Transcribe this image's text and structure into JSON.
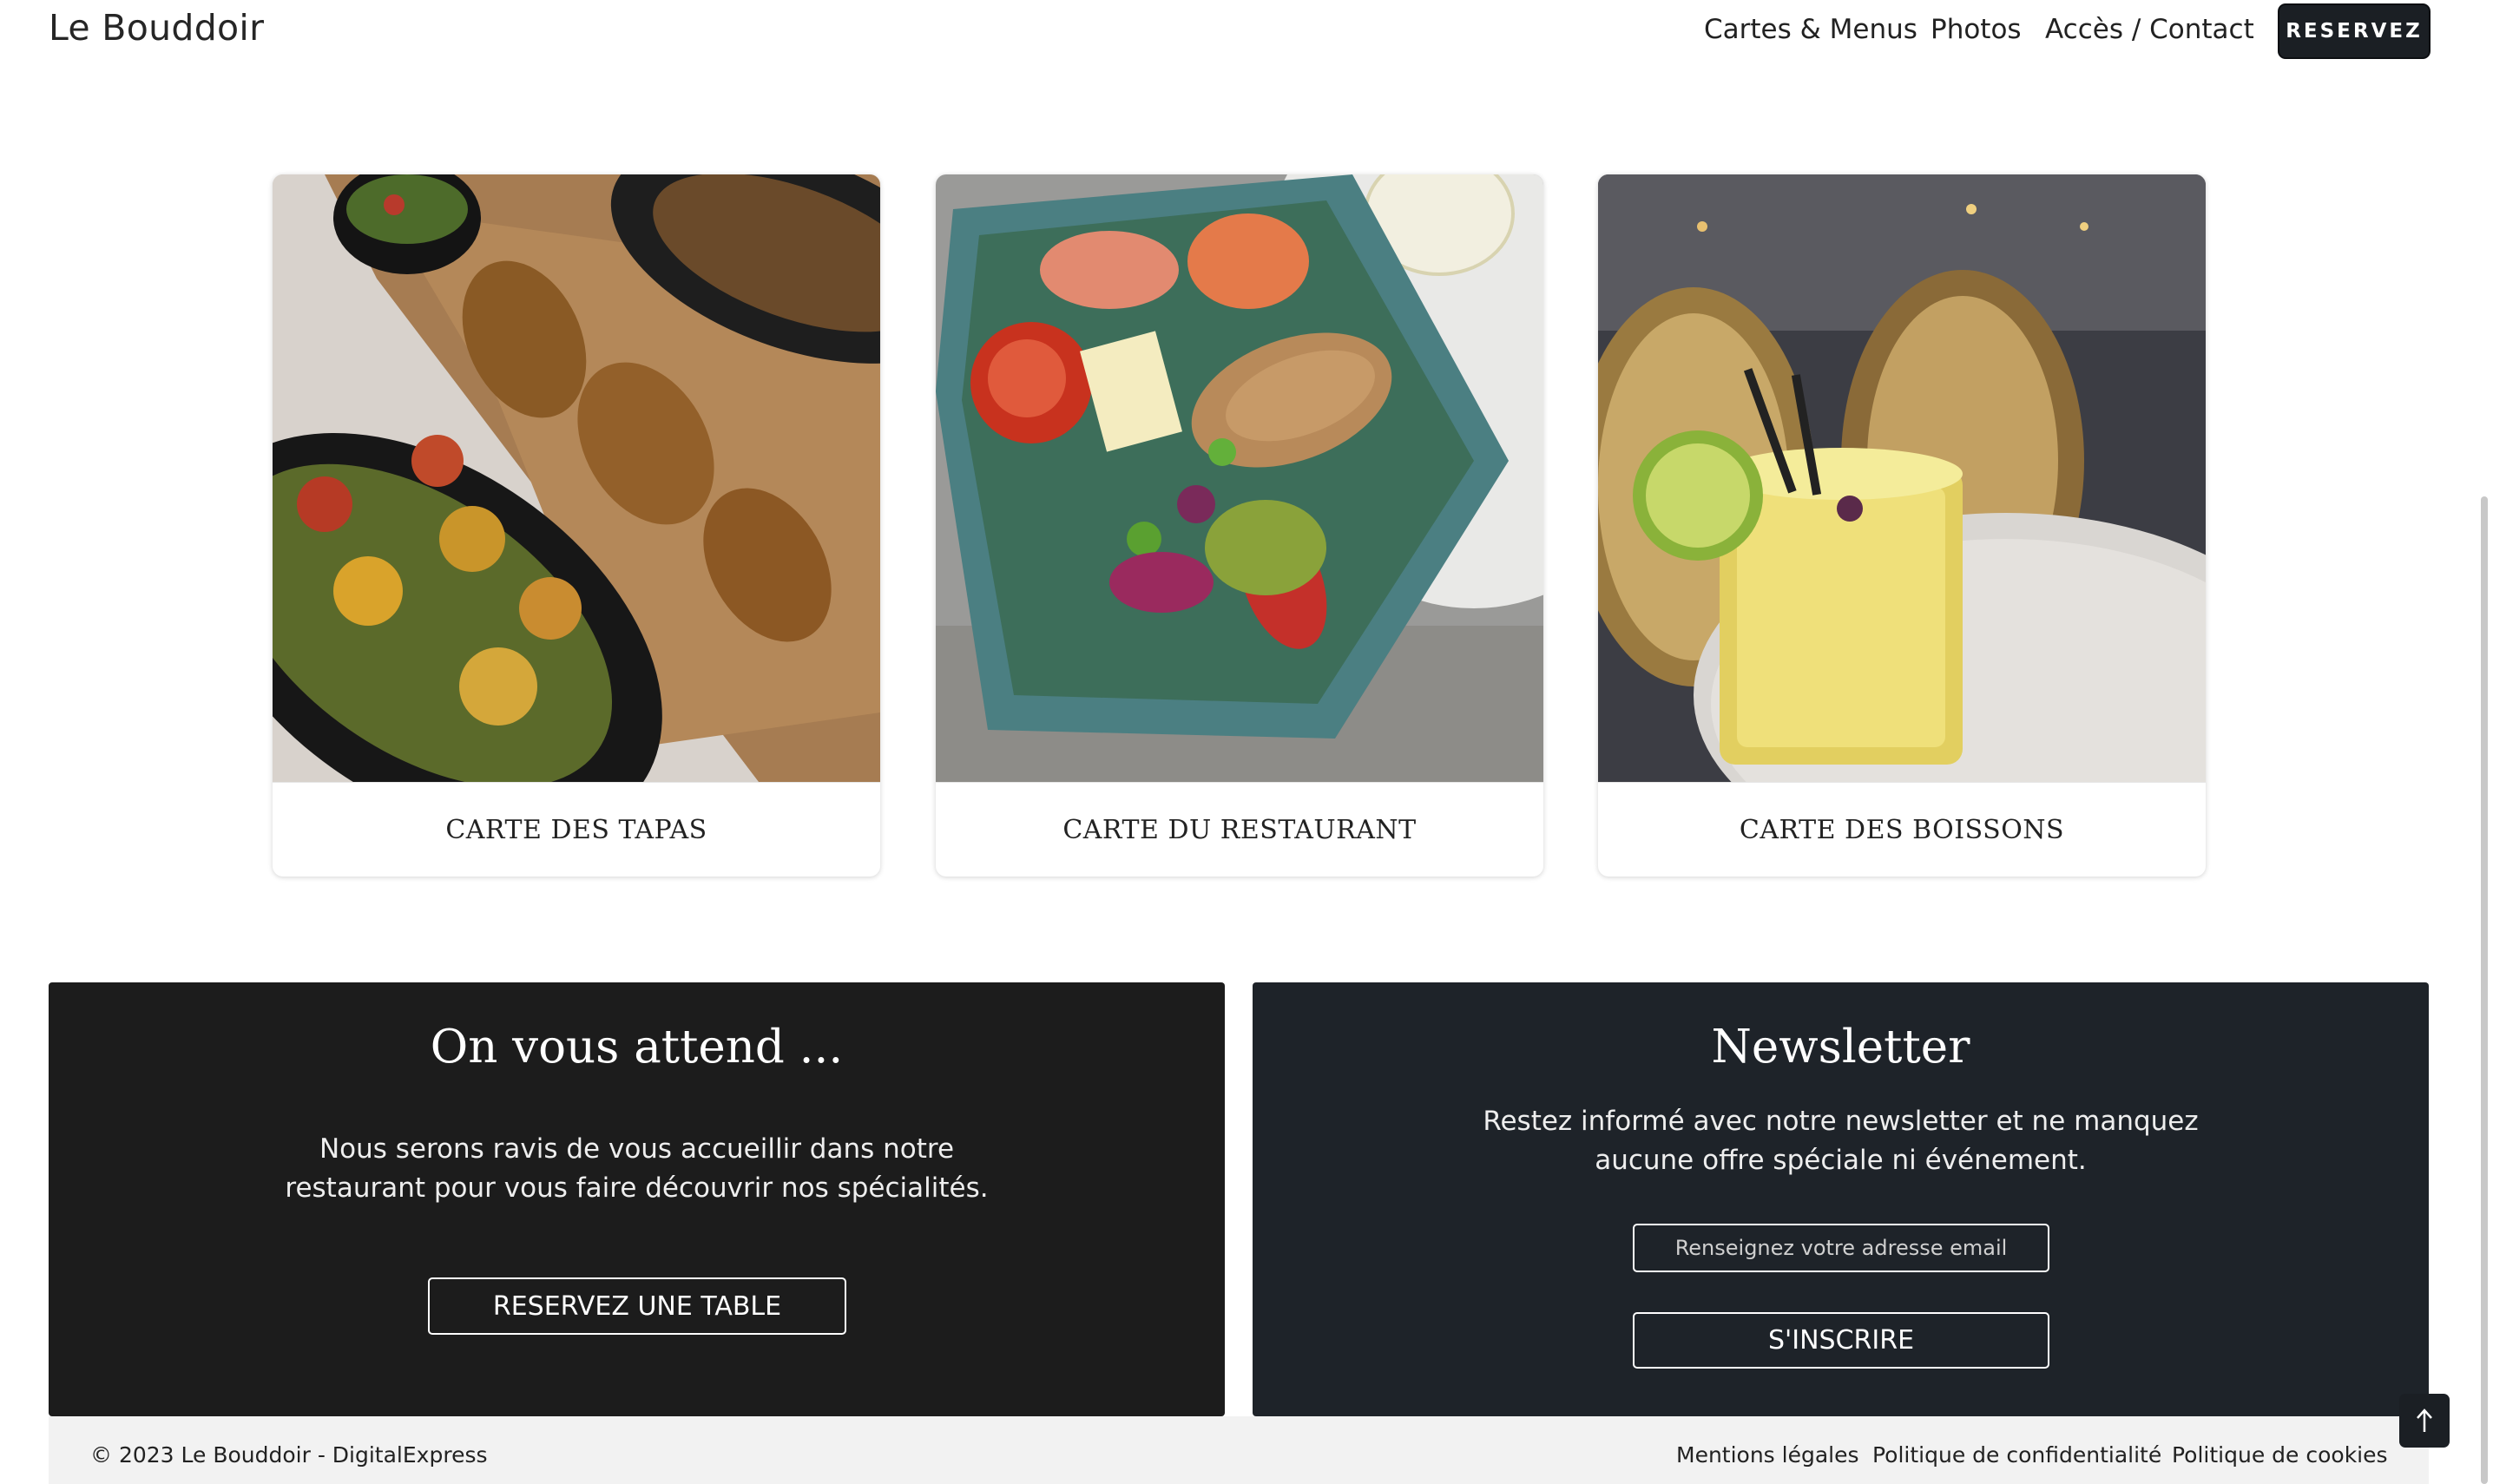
{
  "header": {
    "brand": "Le Bouddoir",
    "nav": [
      "Cartes & Menus",
      "Photos",
      "Accès / Contact"
    ],
    "reserve_label": "RESERVEZ"
  },
  "cards": [
    {
      "label": "CARTE DES TAPAS",
      "image": "tapas-photo"
    },
    {
      "label": "CARTE DU RESTAURANT",
      "image": "salad-photo"
    },
    {
      "label": "CARTE DES BOISSONS",
      "image": "cocktail-photo"
    }
  ],
  "welcome": {
    "title": "On vous attend ...",
    "text_line1": "Nous serons ravis de vous accueillir dans notre",
    "text_line2": "restaurant pour vous faire découvrir nos spécialités.",
    "button": "RESERVEZ UNE TABLE"
  },
  "newsletter": {
    "title": "Newsletter",
    "text_line1": "Restez informé avec notre newsletter et ne manquez",
    "text_line2": "aucune offre spéciale ni événement.",
    "email_placeholder": "Renseignez votre adresse email",
    "button": "S'INSCRIRE"
  },
  "footer": {
    "copyright": "© 2023 Le Bouddoir - DigitalExpress",
    "links": [
      "Mentions légales",
      "Politique de confidentialité",
      "Politique de cookies"
    ]
  },
  "icons": {
    "scroll_top": "arrow-up-icon"
  },
  "colors": {
    "dark_panel_left": "#1c1c1c",
    "dark_panel_right": "#1e2329",
    "button_dark": "#1b1f24"
  }
}
